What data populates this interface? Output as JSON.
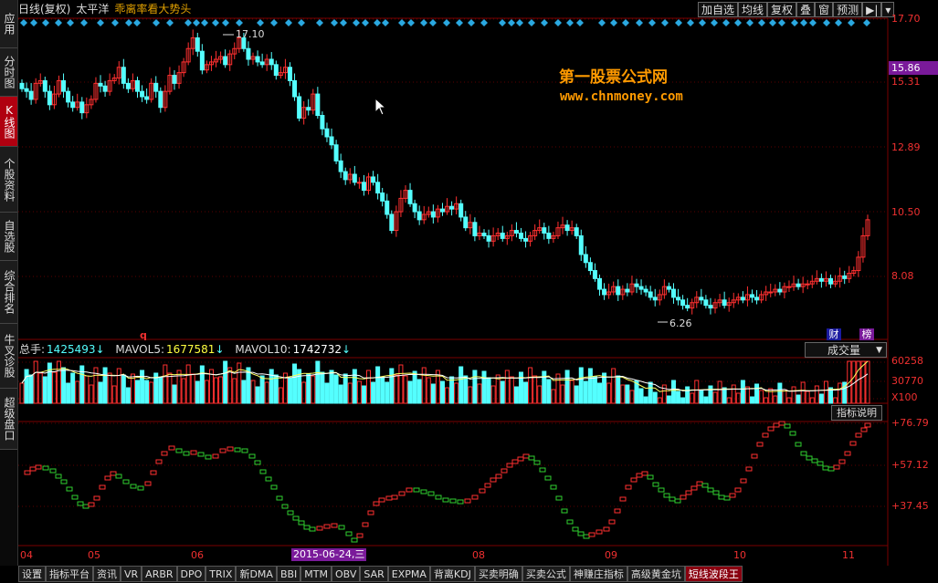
{
  "header": {
    "mode": "日线(复权)",
    "stock_name": "太平洋",
    "indicator": "乖离率看大势头"
  },
  "toolbar": [
    "加自选",
    "均线",
    "复权",
    "叠",
    "窗",
    "预测"
  ],
  "sidebar": [
    {
      "label": "应用",
      "active": false
    },
    {
      "label": "分时图",
      "active": false
    },
    {
      "label": "K线图",
      "active": true
    },
    {
      "label": "个股资料",
      "active": false
    },
    {
      "label": "自选股",
      "active": false
    },
    {
      "label": "综合排名",
      "active": false
    },
    {
      "label": "牛叉诊股",
      "active": false
    },
    {
      "label": "超级盘口",
      "active": false
    }
  ],
  "price_axis": [
    "17.70",
    "15.31",
    "12.89",
    "10.50",
    "8.08"
  ],
  "current_price": "15.86",
  "annotations": {
    "high": "17.10",
    "low": "6.26",
    "q_marker": "q",
    "cai": "财",
    "bang": "榜"
  },
  "watermark": {
    "line1": "第一股票公式网",
    "line2": "www.chnmoney.com"
  },
  "volume": {
    "total_label": "总手:",
    "total": "1425493",
    "ma5_label": "MAVOL5:",
    "ma5": "1677581",
    "ma10_label": "MAVOL10:",
    "ma10": "1742732",
    "dropdown": "成交量",
    "axis": [
      "60258",
      "30770",
      "X100"
    ]
  },
  "indicator_panel": {
    "button": "指标说明",
    "axis": [
      "+76.79",
      "+57.12",
      "+37.45"
    ]
  },
  "dates": [
    "04",
    "05",
    "06",
    "08",
    "09",
    "10",
    "11"
  ],
  "selected_date": "2015-06-24,三",
  "bottom_tabs": [
    "设置",
    "指标平台",
    "资讯",
    "VR",
    "ARBR",
    "DPO",
    "TRIX",
    "新DMA",
    "BBI",
    "MTM",
    "OBV",
    "SAR",
    "EXPMA",
    "背离KDJ",
    "买卖明确",
    "买卖公式",
    "神赚庄指标",
    "高级黄金坑",
    "短线波段王"
  ],
  "colors": {
    "up": "#ff3030",
    "down": "#54ffff",
    "accent": "#7a1a9a",
    "grid": "#5a0000"
  }
}
